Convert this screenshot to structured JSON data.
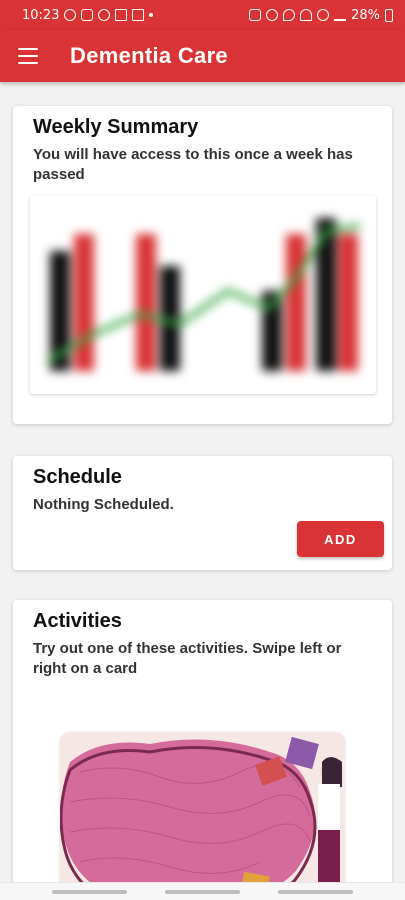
{
  "status_bar": {
    "time": "10:23",
    "battery": "28%"
  },
  "app_bar": {
    "title": "Dementia Care",
    "menu_icon": "hamburger-menu-icon"
  },
  "weekly_summary": {
    "title": "Weekly Summary",
    "subtitle": "You will access to this once a week has passed",
    "subtitle_exact": "You will have access to this once a week has passed",
    "preview_state": "blurred"
  },
  "schedule": {
    "title": "Schedule",
    "empty_text": "Nothing Scheduled.",
    "add_label": "ADD"
  },
  "activities": {
    "title": "Activities",
    "instructions": "Try out one of these activities. Swipe left or right on a card"
  },
  "colors": {
    "brand_red": "#d93335",
    "bar_black": "#111111",
    "bar_red": "#d93335",
    "line_green": "#3aa845"
  }
}
